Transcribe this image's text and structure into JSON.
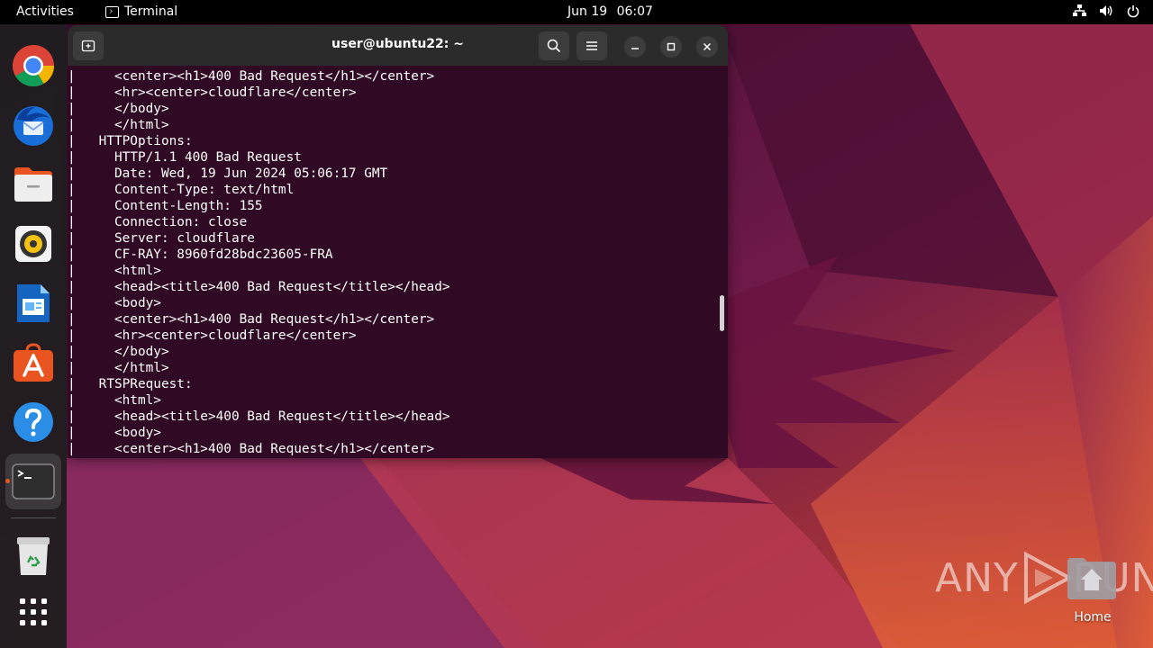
{
  "topbar": {
    "activities": "Activities",
    "app_name": "Terminal",
    "date": "Jun 19",
    "time": "06:07"
  },
  "dock": {
    "items": [
      {
        "name": "chrome",
        "icon": "chrome-icon"
      },
      {
        "name": "thunderbird",
        "icon": "thunderbird-icon"
      },
      {
        "name": "files",
        "icon": "files-icon"
      },
      {
        "name": "rhythmbox",
        "icon": "rhythmbox-icon"
      },
      {
        "name": "libreoffice-writer",
        "icon": "writer-icon"
      },
      {
        "name": "app-center",
        "icon": "app-center-icon"
      },
      {
        "name": "help",
        "icon": "help-icon"
      },
      {
        "name": "terminal",
        "icon": "terminal-icon",
        "running": true
      },
      {
        "name": "trash",
        "icon": "trash-icon"
      },
      {
        "name": "show-apps",
        "icon": "grid-icon"
      }
    ]
  },
  "terminal": {
    "title": "user@ubuntu22: ~",
    "lines": [
      "|     <center><h1>400 Bad Request</h1></center>",
      "|     <hr><center>cloudflare</center>",
      "|     </body>",
      "|     </html>",
      "|   HTTPOptions:",
      "|     HTTP/1.1 400 Bad Request",
      "|     Date: Wed, 19 Jun 2024 05:06:17 GMT",
      "|     Content-Type: text/html",
      "|     Content-Length: 155",
      "|     Connection: close",
      "|     Server: cloudflare",
      "|     CF-RAY: 8960fd28bdc23605-FRA",
      "|     <html>",
      "|     <head><title>400 Bad Request</title></head>",
      "|     <body>",
      "|     <center><h1>400 Bad Request</h1></center>",
      "|     <hr><center>cloudflare</center>",
      "|     </body>",
      "|     </html>",
      "|   RTSPRequest:",
      "|     <html>",
      "|     <head><title>400 Bad Request</title></head>",
      "|     <body>",
      "|     <center><h1>400 Bad Request</h1></center>"
    ]
  },
  "watermark": {
    "text_left": "ANY",
    "text_right": "RUN"
  },
  "desktop": {
    "home_label": "Home"
  },
  "colors": {
    "terminal_bg": "#300a24",
    "accent": "#e95420",
    "header_bg": "#2b2b2b"
  }
}
